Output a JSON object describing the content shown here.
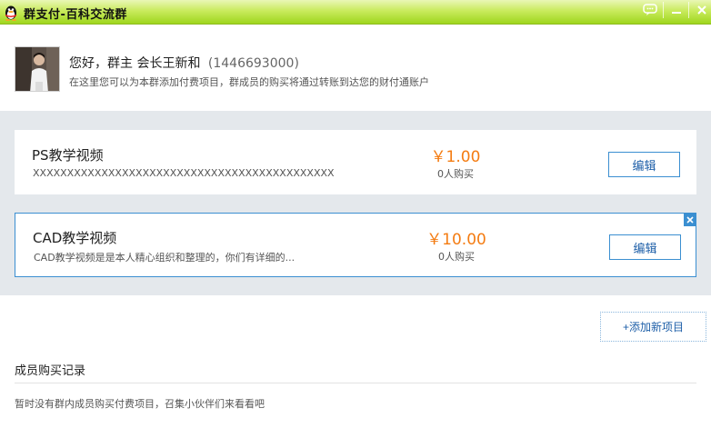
{
  "window": {
    "title": "群支付-百科交流群"
  },
  "header": {
    "greeting": "您好，群主 会长王新和",
    "qq_number": "(1446693000)",
    "subtitle": "在这里您可以为本群添加付费项目，群成员的购买将通过转账到达您的财付通账户"
  },
  "items": [
    {
      "name": "PS教学视频",
      "description": "XXXXXXXXXXXXXXXXXXXXXXXXXXXXXXXXXXXXXXXXXXXX",
      "price": "￥1.00",
      "buyers": "0人购买",
      "edit_label": "编辑"
    },
    {
      "name": "CAD教学视频",
      "description": "CAD教学视频是是本人精心组织和整理的，你们有详细的...",
      "price": "￥10.00",
      "buyers": "0人购买",
      "edit_label": "编辑"
    }
  ],
  "add_button": "+添加新项目",
  "records": {
    "title": "成员购买记录",
    "empty_text": "暂时没有群内成员购买付费项目，召集小伙伴们来看看吧"
  },
  "colors": {
    "titlebar": "#9fd61e",
    "accent": "#3b8fd1",
    "price": "#f47c12",
    "band": "#e4e8ec"
  }
}
